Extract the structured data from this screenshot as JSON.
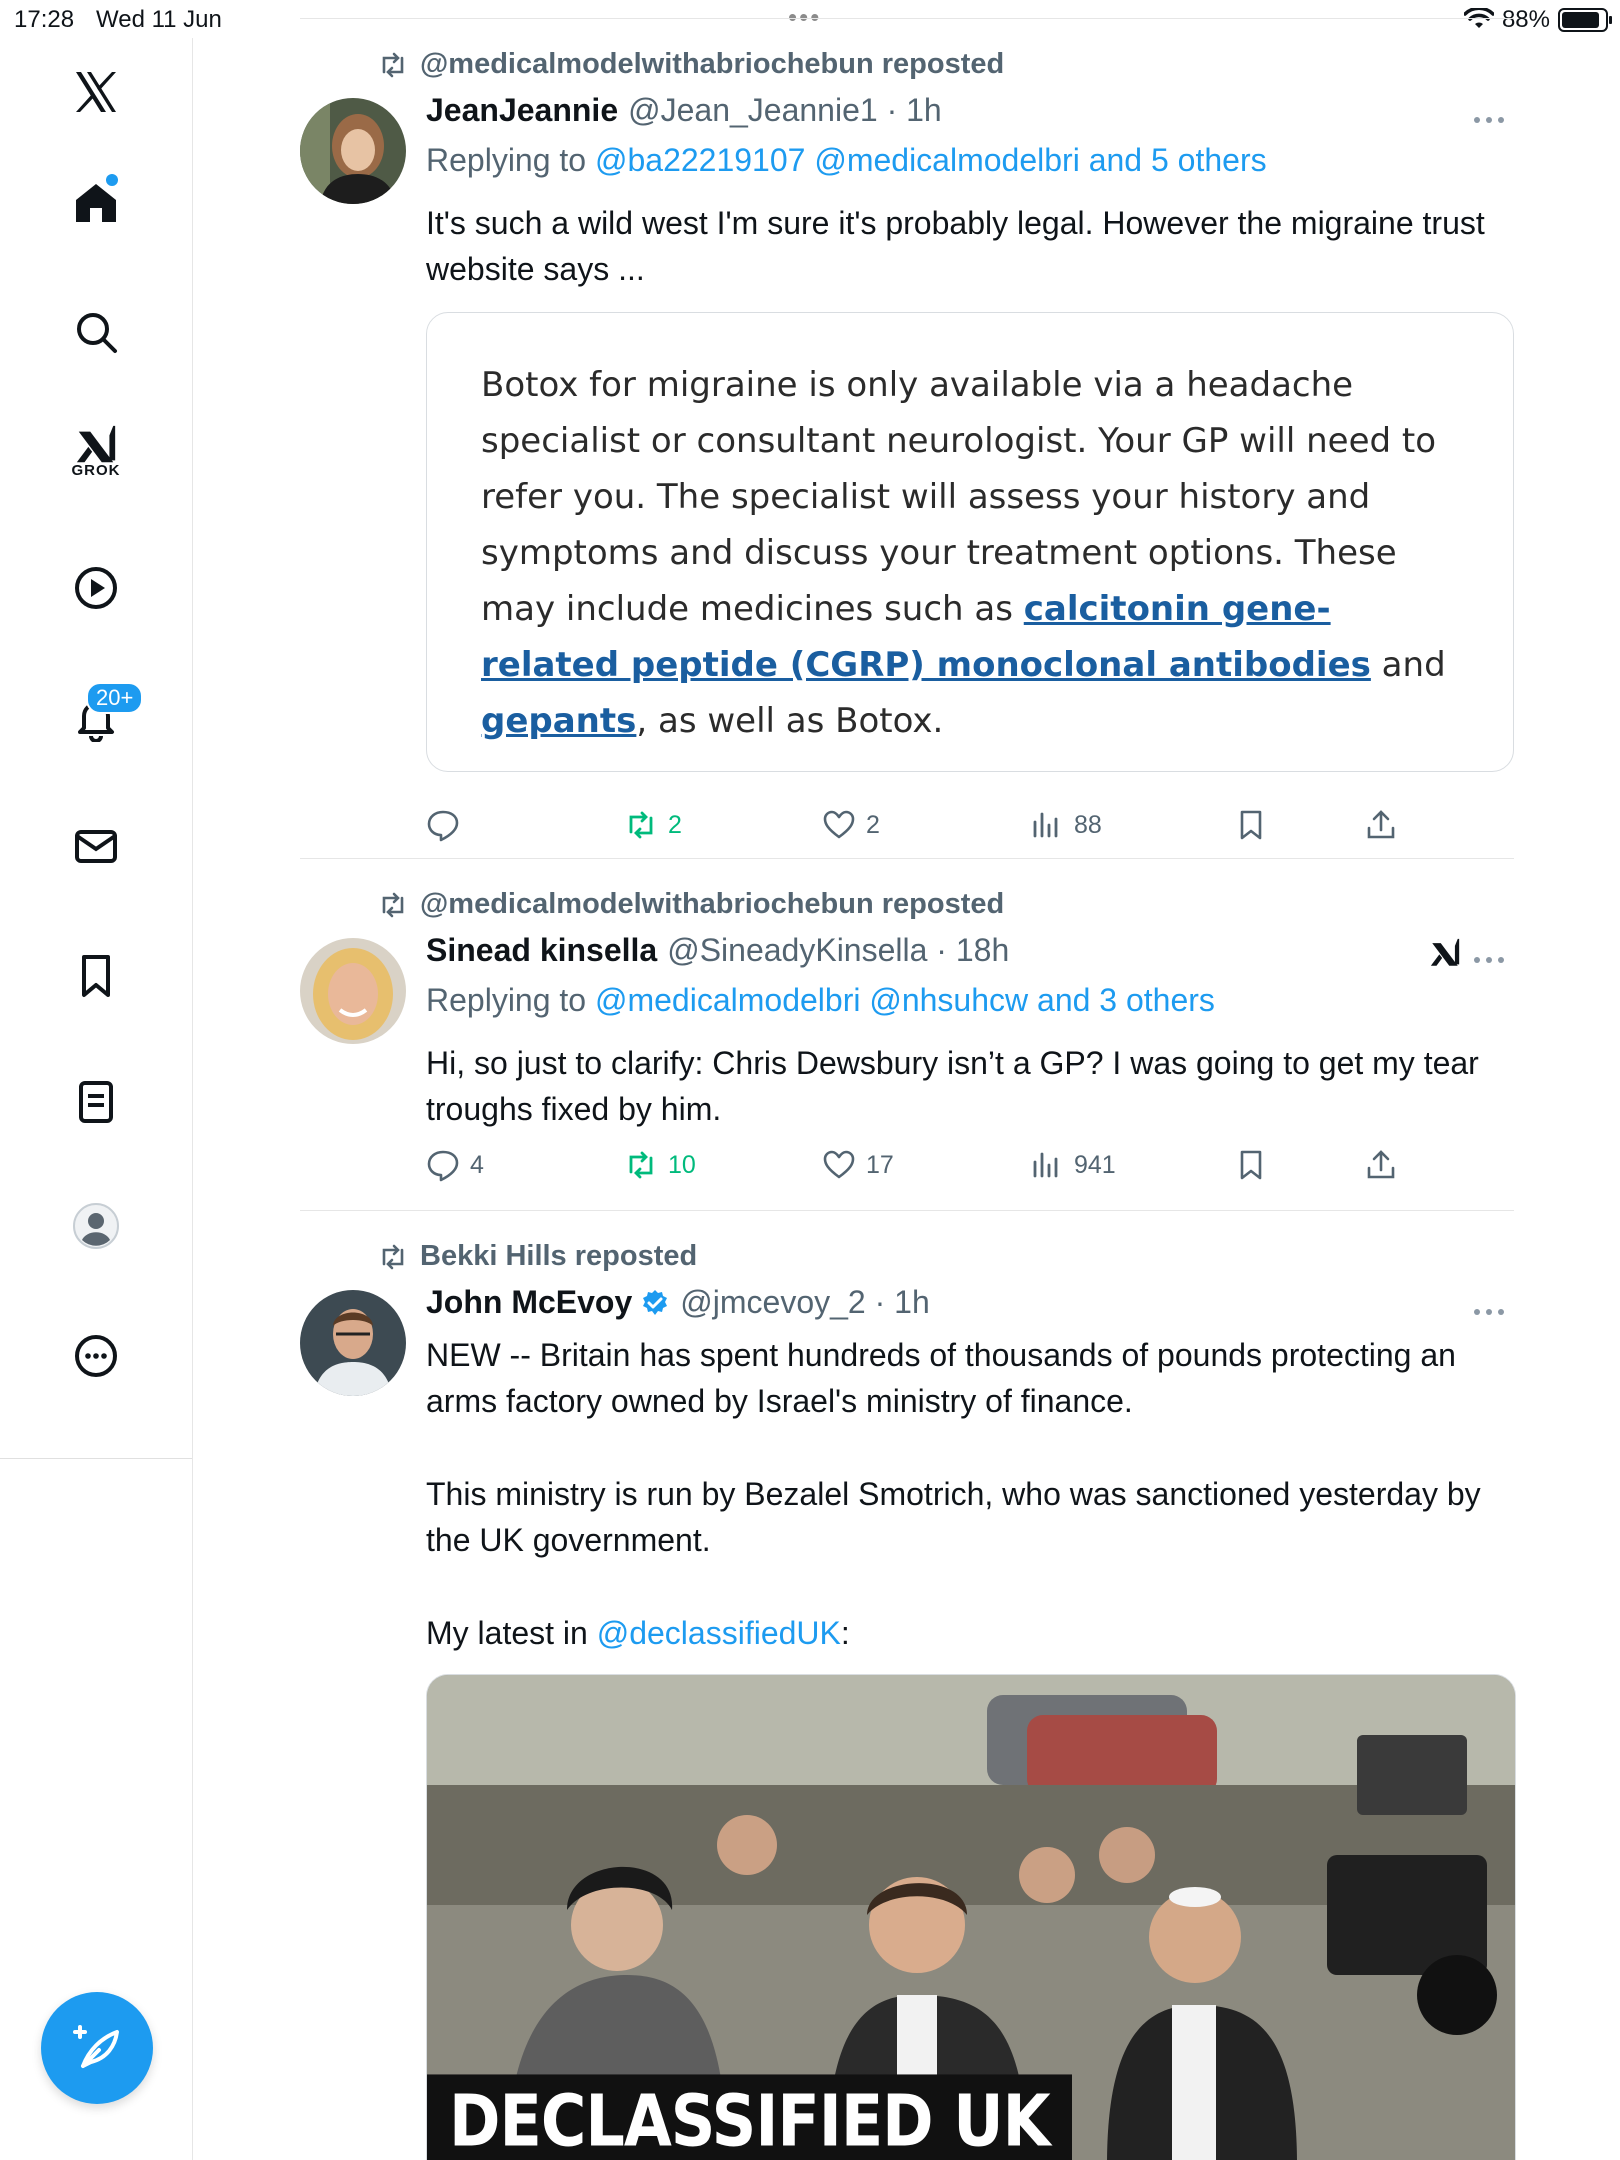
{
  "status_bar": {
    "time": "17:28",
    "date": "Wed 11 Jun",
    "battery": "88%"
  },
  "sidebar": {
    "grok_label": "GROK",
    "notifications_badge": "20+"
  },
  "tweets": [
    {
      "repost_by": "@medicalmodelwithabriochebun reposted",
      "name": "JeanJeannie",
      "handle": "@Jean_Jeannie1 · 1h",
      "replying_prefix": "Replying to ",
      "replying_to": "@ba22219107 @medicalmodelbri and 5 others",
      "text": "It's such a wild west I'm sure it's probably legal. However the migraine trust website says ...",
      "quote": {
        "part1": "Botox for migraine is only available via a headache specialist or consultant neurologist. Your GP will need to refer you. The specialist will assess your history and symptoms and discuss your treatment options. These may include medicines such as ",
        "link1": "calcitonin gene-related peptide (CGRP) monoclonal antibodies",
        "part2": " and ",
        "link2": "gepants",
        "part3": ", as well as Botox."
      },
      "stats": {
        "replies": "",
        "reposts": "2",
        "likes": "2",
        "views": "88"
      }
    },
    {
      "repost_by": "@medicalmodelwithabriochebun reposted",
      "name": "Sinead kinsella",
      "handle": "@SineadyKinsella · 18h",
      "replying_prefix": "Replying to ",
      "replying_to": "@medicalmodelbri @nhsuhcw and 3 others",
      "text": "Hi, so just to clarify: Chris Dewsbury isn’t a GP? I was going to get my tear troughs fixed by him.",
      "stats": {
        "replies": "4",
        "reposts": "10",
        "likes": "17",
        "views": "941"
      }
    },
    {
      "repost_by": "Bekki Hills reposted",
      "name": "John McEvoy",
      "handle": "@jmcevoy_2 · 1h",
      "text1": "NEW -- Britain has spent hundreds of thousands of pounds protecting an arms factory owned by Israel's ministry of finance.",
      "text2": "This ministry is run by Bezalel Smotrich, who was sanctioned yesterday by the UK government.",
      "text3_prefix": "My latest in ",
      "text3_link": "@declassifiedUK",
      "text3_suffix": ":",
      "media_banner": "DECLASSIFIED UK"
    }
  ],
  "colors": {
    "accent": "#1d9bf0",
    "repost_green": "#00ba7c",
    "muted": "#536471",
    "quote_link": "#1a5ea0"
  }
}
